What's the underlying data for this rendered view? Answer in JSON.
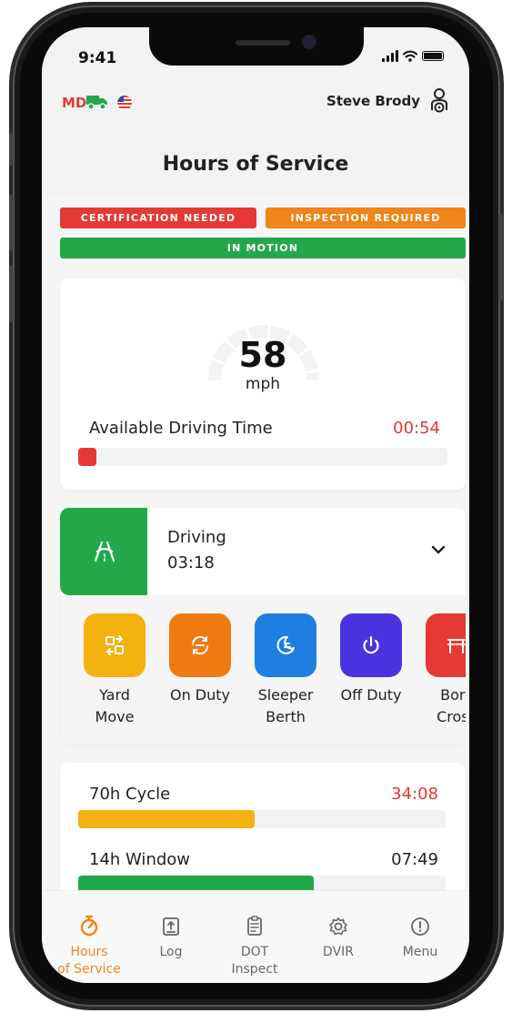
{
  "status_bar": {
    "time": "9:41"
  },
  "header": {
    "state_code": "MD",
    "user_name": "Steve Brody",
    "title": "Hours of Service"
  },
  "badges": {
    "certification": "CERTIFICATION NEEDED",
    "inspection": "INSPECTION REQUIRED",
    "motion": "IN MOTION"
  },
  "speed_card": {
    "speed": "58",
    "unit": "mph",
    "available_label": "Available Driving Time",
    "available_value": "00:54",
    "available_fraction": 0.05
  },
  "duty": {
    "current_status": "Driving",
    "current_time": "03:18",
    "options": [
      {
        "label_line1": "Yard",
        "label_line2": "Move",
        "color": "#f3b20f",
        "icon": "yard-move-icon"
      },
      {
        "label_line1": "On Duty",
        "label_line2": "",
        "color": "#f07a12",
        "icon": "on-duty-icon"
      },
      {
        "label_line1": "Sleeper",
        "label_line2": "Berth",
        "color": "#1f7fe0",
        "icon": "sleeper-berth-icon"
      },
      {
        "label_line1": "Off Duty",
        "label_line2": "",
        "color": "#4b33e0",
        "icon": "power-icon"
      },
      {
        "label_line1": "Borc",
        "label_line2": "Cross",
        "color": "#e53935",
        "icon": "border-crossing-icon"
      }
    ]
  },
  "cycles": [
    {
      "label": "70h Cycle",
      "value": "34:08",
      "value_color": "#e53935",
      "bar_color": "#f3b20f",
      "fraction": 0.48
    },
    {
      "label": "14h Window",
      "value": "07:49",
      "value_color": "#222222",
      "bar_color": "#22a84b",
      "fraction": 0.64
    }
  ],
  "nav": [
    {
      "line1": "Hours",
      "line2": "of Service",
      "icon": "stopwatch-icon",
      "active": true
    },
    {
      "line1": "Log",
      "line2": "",
      "icon": "upload-log-icon",
      "active": false
    },
    {
      "line1": "DOT",
      "line2": "Inspect",
      "icon": "clipboard-icon",
      "active": false
    },
    {
      "line1": "DVIR",
      "line2": "",
      "icon": "gear-icon",
      "active": false
    },
    {
      "line1": "Menu",
      "line2": "",
      "icon": "info-icon",
      "active": false
    }
  ],
  "colors": {
    "accent": "#f08519",
    "red": "#e53935",
    "green": "#22a84b",
    "orange": "#f08519"
  }
}
